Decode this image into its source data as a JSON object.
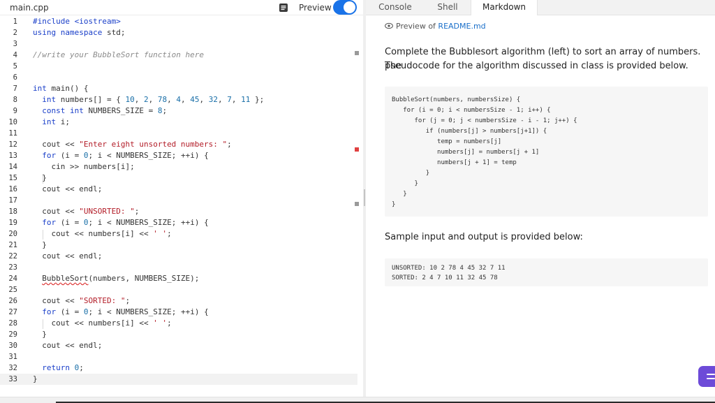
{
  "editor": {
    "file_tab": "main.cpp",
    "preview_label": "Preview",
    "preview_toggle_on": true,
    "lines": [
      {
        "n": "1",
        "tokens": [
          [
            "pre",
            "#include <iostream>"
          ]
        ]
      },
      {
        "n": "2",
        "tokens": [
          [
            "kw",
            "using namespace"
          ],
          [
            "",
            " std;"
          ]
        ]
      },
      {
        "n": "3",
        "tokens": []
      },
      {
        "n": "4",
        "tokens": [
          [
            "cmt",
            "//write your BubbleSort function here"
          ]
        ]
      },
      {
        "n": "5",
        "tokens": []
      },
      {
        "n": "6",
        "tokens": []
      },
      {
        "n": "7",
        "tokens": [
          [
            "kw",
            "int"
          ],
          [
            "",
            " main() {"
          ]
        ]
      },
      {
        "n": "8",
        "tokens": [
          [
            "",
            "  "
          ],
          [
            "kw",
            "int"
          ],
          [
            "",
            " numbers[] = { "
          ],
          [
            "num",
            "10"
          ],
          [
            "",
            ", "
          ],
          [
            "num",
            "2"
          ],
          [
            "",
            ", "
          ],
          [
            "num",
            "78"
          ],
          [
            "",
            ", "
          ],
          [
            "num",
            "4"
          ],
          [
            "",
            ", "
          ],
          [
            "num",
            "45"
          ],
          [
            "",
            ", "
          ],
          [
            "num",
            "32"
          ],
          [
            "",
            ", "
          ],
          [
            "num",
            "7"
          ],
          [
            "",
            ", "
          ],
          [
            "num",
            "11"
          ],
          [
            "",
            " };"
          ]
        ]
      },
      {
        "n": "9",
        "tokens": [
          [
            "",
            "  "
          ],
          [
            "kw",
            "const int"
          ],
          [
            "",
            " NUMBERS_SIZE = "
          ],
          [
            "num",
            "8"
          ],
          [
            "",
            ";"
          ]
        ]
      },
      {
        "n": "10",
        "tokens": [
          [
            "",
            "  "
          ],
          [
            "kw",
            "int"
          ],
          [
            "",
            " i;"
          ]
        ]
      },
      {
        "n": "11",
        "tokens": []
      },
      {
        "n": "12",
        "tokens": [
          [
            "",
            "  cout << "
          ],
          [
            "str",
            "\"Enter eight unsorted numbers: \""
          ],
          [
            "",
            ";"
          ]
        ]
      },
      {
        "n": "13",
        "tokens": [
          [
            "",
            "  "
          ],
          [
            "kw",
            "for"
          ],
          [
            "",
            " (i = "
          ],
          [
            "num",
            "0"
          ],
          [
            "",
            "; i < NUMBERS_SIZE; ++i) {"
          ]
        ]
      },
      {
        "n": "14",
        "tokens": [
          [
            "",
            "    cin >> numbers[i];"
          ]
        ]
      },
      {
        "n": "15",
        "tokens": [
          [
            "",
            "  }"
          ]
        ]
      },
      {
        "n": "16",
        "tokens": [
          [
            "",
            "  cout << endl;"
          ]
        ]
      },
      {
        "n": "17",
        "tokens": []
      },
      {
        "n": "18",
        "tokens": [
          [
            "",
            "  cout << "
          ],
          [
            "str",
            "\"UNSORTED: \""
          ],
          [
            "",
            ";"
          ]
        ]
      },
      {
        "n": "19",
        "tokens": [
          [
            "",
            "  "
          ],
          [
            "kw",
            "for"
          ],
          [
            "",
            " (i = "
          ],
          [
            "num",
            "0"
          ],
          [
            "",
            "; i < NUMBERS_SIZE; ++i) {"
          ]
        ]
      },
      {
        "n": "20",
        "tokens": [
          [
            "",
            "    cout << numbers[i] << "
          ],
          [
            "str",
            "' '"
          ],
          [
            "",
            ";"
          ]
        ]
      },
      {
        "n": "21",
        "tokens": [
          [
            "",
            "  }"
          ]
        ]
      },
      {
        "n": "22",
        "tokens": [
          [
            "",
            "  cout << endl;"
          ]
        ]
      },
      {
        "n": "23",
        "tokens": []
      },
      {
        "n": "24",
        "tokens": [
          [
            "",
            "  "
          ],
          [
            "sq",
            "BubbleSort"
          ],
          [
            "",
            "(numbers, NUMBERS_SIZE);"
          ]
        ]
      },
      {
        "n": "25",
        "tokens": []
      },
      {
        "n": "26",
        "tokens": [
          [
            "",
            "  cout << "
          ],
          [
            "str",
            "\"SORTED: \""
          ],
          [
            "",
            ";"
          ]
        ]
      },
      {
        "n": "27",
        "tokens": [
          [
            "",
            "  "
          ],
          [
            "kw",
            "for"
          ],
          [
            "",
            " (i = "
          ],
          [
            "num",
            "0"
          ],
          [
            "",
            "; i < NUMBERS_SIZE; ++i) {"
          ]
        ]
      },
      {
        "n": "28",
        "tokens": [
          [
            "",
            "    cout << numbers[i] << "
          ],
          [
            "str",
            "' '"
          ],
          [
            "",
            ";"
          ]
        ]
      },
      {
        "n": "29",
        "tokens": [
          [
            "",
            "  }"
          ]
        ]
      },
      {
        "n": "30",
        "tokens": [
          [
            "",
            "  cout << endl;"
          ]
        ]
      },
      {
        "n": "31",
        "tokens": []
      },
      {
        "n": "32",
        "tokens": [
          [
            "",
            "  "
          ],
          [
            "kw",
            "return"
          ],
          [
            "",
            " "
          ],
          [
            "num",
            "0"
          ],
          [
            "",
            ";"
          ]
        ]
      },
      {
        "n": "33",
        "tokens": [
          [
            "",
            "}"
          ]
        ]
      }
    ],
    "current_line": "33"
  },
  "right_panel": {
    "tabs": [
      {
        "label": "Console",
        "active": false
      },
      {
        "label": "Shell",
        "active": false
      },
      {
        "label": "Markdown",
        "active": true
      }
    ],
    "preview_prefix": "Preview of ",
    "preview_file": "README.md",
    "intro_line1": "Complete the Bubblesort algorithm (left) to sort an array of numbers. The",
    "intro_line2": "pseudocode for the algorithm discussed in class is provided below.",
    "pseudocode": [
      "BubbleSort(numbers, numbersSize) {",
      "   for (i = 0; i < numbersSize - 1; i++) {",
      "      for (j = 0; j < numbersSize - i - 1; j++) {",
      "         if (numbers[j] > numbers[j+1]) {",
      "            temp = numbers[j]",
      "            numbers[j] = numbers[j + 1]",
      "            numbers[j + 1] = temp",
      "         }",
      "      }",
      "   }",
      "}"
    ],
    "sample_text": "Sample input and output is provided below:",
    "sample_output": [
      "UNSORTED: 10 2 78 4 45 32 7 11",
      "SORTED: 2 4 7 10 11 32 45 78"
    ]
  },
  "colors": {
    "accent": "#1a73e8",
    "fab": "#6d4bd8",
    "marker_gray": "#9a9a9a",
    "marker_red": "#e04040"
  },
  "icons": {
    "preview": "book-icon",
    "readme": "eye-icon",
    "fab": "menu-icon"
  }
}
